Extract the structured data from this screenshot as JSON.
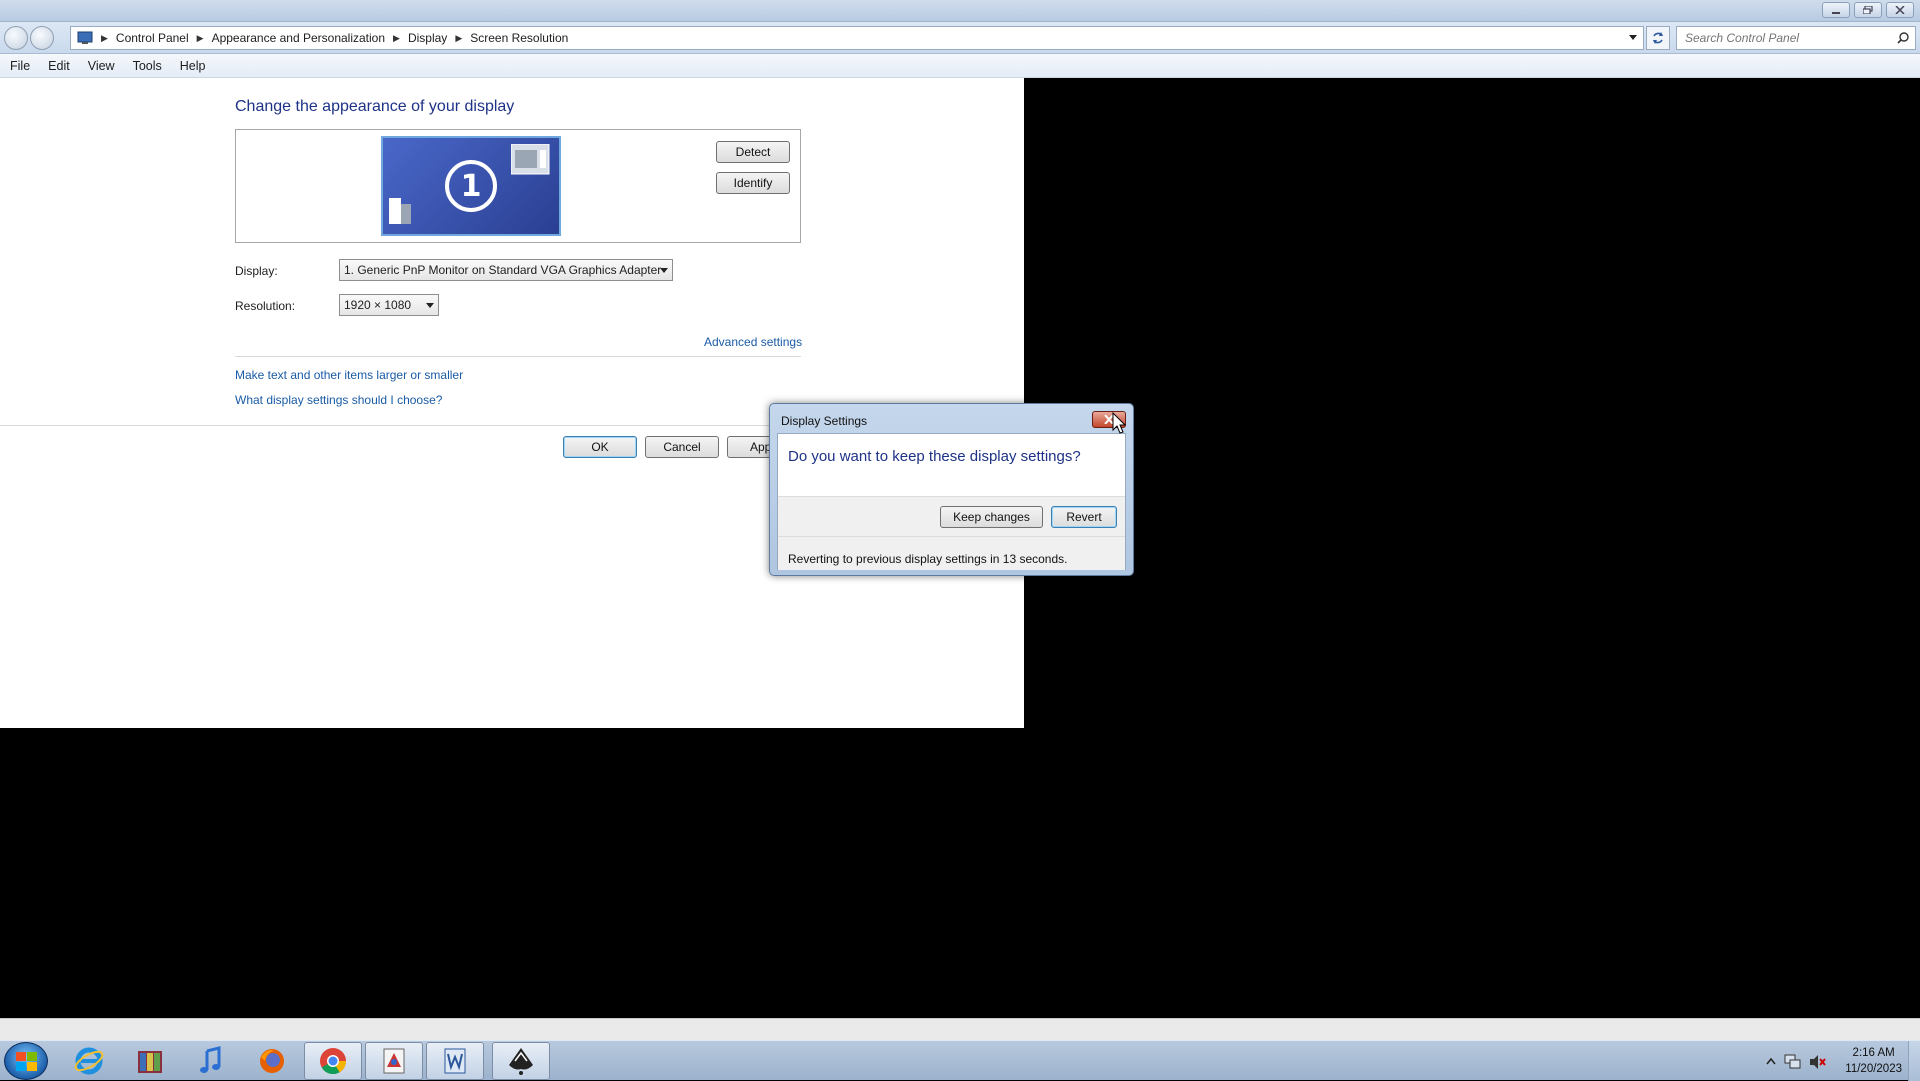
{
  "addressbar": {
    "breadcrumbs": [
      "Control Panel",
      "Appearance and Personalization",
      "Display",
      "Screen Resolution"
    ],
    "search_placeholder": "Search Control Panel"
  },
  "menubar": [
    "File",
    "Edit",
    "View",
    "Tools",
    "Help"
  ],
  "content": {
    "title": "Change the appearance of your display",
    "monitor_number": "1",
    "detect_label": "Detect",
    "identify_label": "Identify",
    "display_label": "Display:",
    "display_value": "1. Generic PnP Monitor on Standard VGA Graphics Adapter",
    "resolution_label": "Resolution:",
    "resolution_value": "1920 × 1080",
    "advanced_link": "Advanced settings",
    "link_text_size": "Make text and other items larger or smaller",
    "link_what_settings": "What display settings should I choose?",
    "ok_label": "OK",
    "cancel_label": "Cancel",
    "apply_label": "Apply"
  },
  "dialog": {
    "title": "Display Settings",
    "question": "Do you want to keep these display settings?",
    "keep_label": "Keep changes",
    "revert_label": "Revert",
    "countdown": "Reverting to previous display settings in 13 seconds."
  },
  "taskbar": {
    "apps": [
      "internet-explorer",
      "file-archive",
      "itunes",
      "firefox",
      "chrome",
      "paint-app",
      "word-app",
      "inkscape-app"
    ],
    "time": "2:16 AM",
    "date": "11/20/2023"
  }
}
